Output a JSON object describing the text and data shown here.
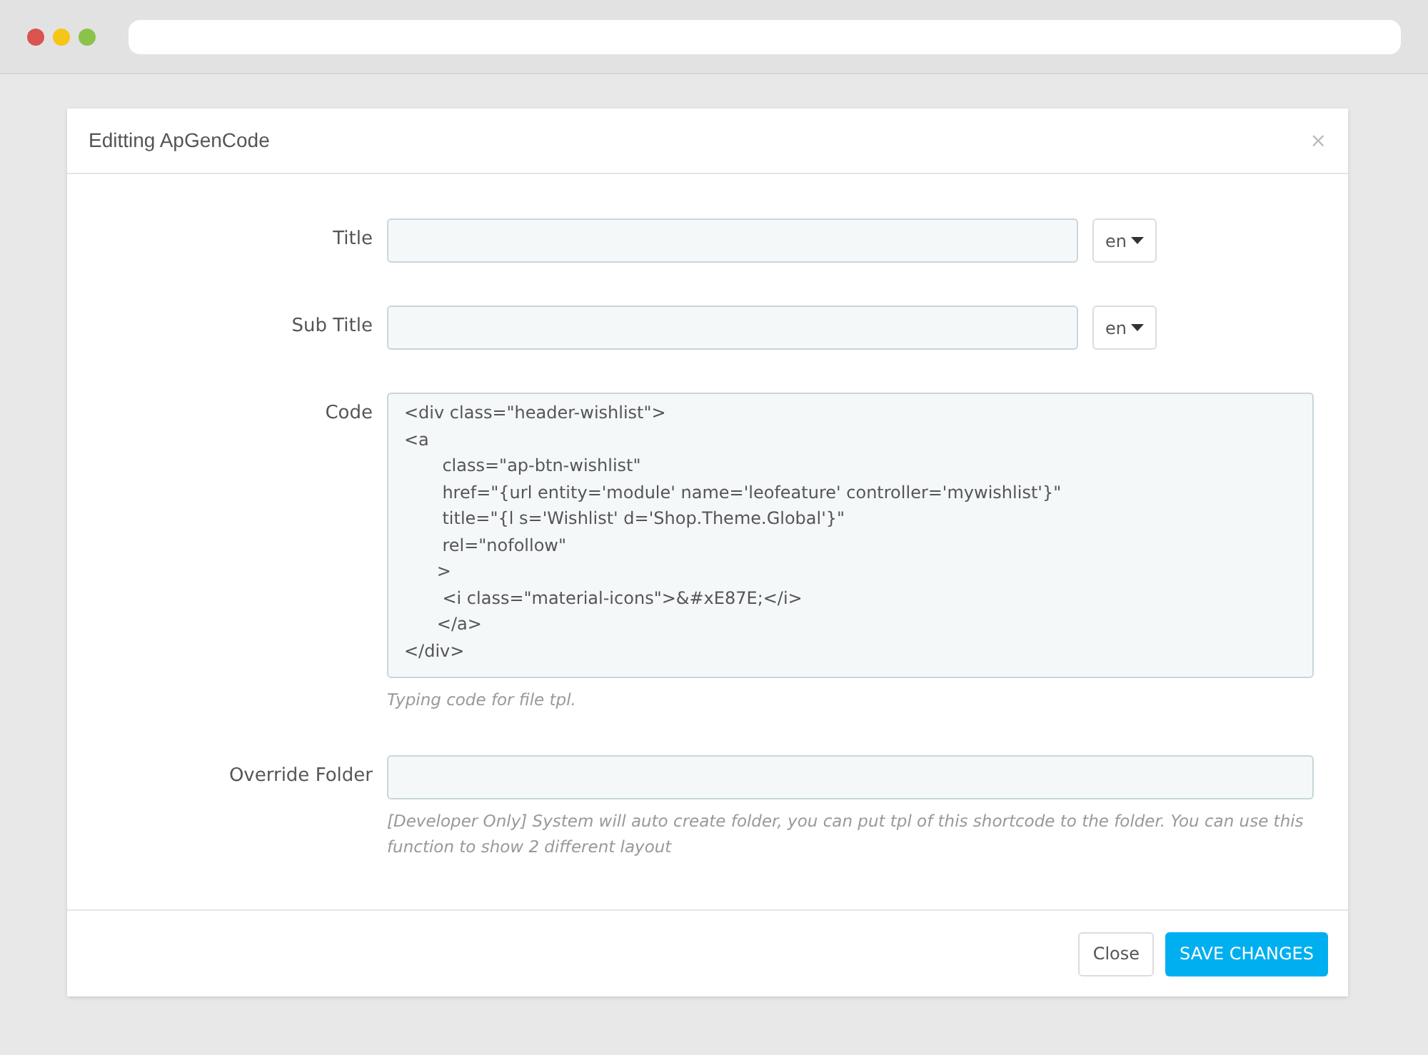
{
  "modal": {
    "title": "Editting ApGenCode",
    "close": "×"
  },
  "fields": [
    {
      "kind": "text",
      "label": "Title",
      "language": "en"
    },
    {
      "kind": "text",
      "label": "Sub Title",
      "language": "en"
    },
    {
      "kind": "code",
      "label": "Code",
      "value": "<div class=\"header-wishlist\">\n<a\n       class=\"ap-btn-wishlist\"\n       href=\"{url entity='module' name='leofeature' controller='mywishlist'}\"\n       title=\"{l s='Wishlist' d='Shop.Theme.Global'}\"\n       rel=\"nofollow\"\n      >\n       <i class=\"material-icons\">&#xE87E;</i>\n      </a>\n</div>",
      "help": "Typing code for file tpl."
    },
    {
      "kind": "text",
      "label": "Override Folder",
      "help": "[Developer Only] System will auto create folder, you can put tpl of this shortcode to the folder. You can use this function to show 2 different layout"
    }
  ],
  "buttons": [
    {
      "label": "Close",
      "kind": "default"
    },
    {
      "label": "SAVE CHANGES",
      "kind": "primary"
    }
  ]
}
